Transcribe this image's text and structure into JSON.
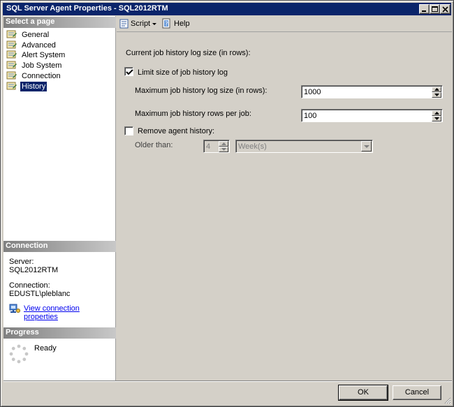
{
  "window": {
    "title": "SQL Server Agent Properties - SQL2012RTM"
  },
  "left": {
    "select_page_header": "Select a page",
    "pages": [
      {
        "label": "General",
        "selected": false
      },
      {
        "label": "Advanced",
        "selected": false
      },
      {
        "label": "Alert System",
        "selected": false
      },
      {
        "label": "Job System",
        "selected": false
      },
      {
        "label": "Connection",
        "selected": false
      },
      {
        "label": "History",
        "selected": true
      }
    ],
    "connection_header": "Connection",
    "server_label": "Server:",
    "server_value": "SQL2012RTM",
    "connection_label": "Connection:",
    "connection_value": "EDUSTL\\pleblanc",
    "view_conn_link": "View connection properties",
    "progress_header": "Progress",
    "progress_status": "Ready"
  },
  "toolbar": {
    "script_label": "Script",
    "help_label": "Help"
  },
  "history": {
    "current_log_size_label": "Current job history log size (in rows):",
    "limit_size_label": "Limit size of job history log",
    "limit_size_checked": true,
    "max_log_size_label": "Maximum job history log size (in rows):",
    "max_log_size_value": "1000",
    "max_rows_per_job_label": "Maximum job history rows per job:",
    "max_rows_per_job_value": "100",
    "remove_history_label": "Remove agent history:",
    "remove_history_checked": false,
    "older_than_label": "Older than:",
    "older_than_value": "4",
    "older_than_unit": "Week(s)"
  },
  "buttons": {
    "ok": "OK",
    "cancel": "Cancel"
  }
}
